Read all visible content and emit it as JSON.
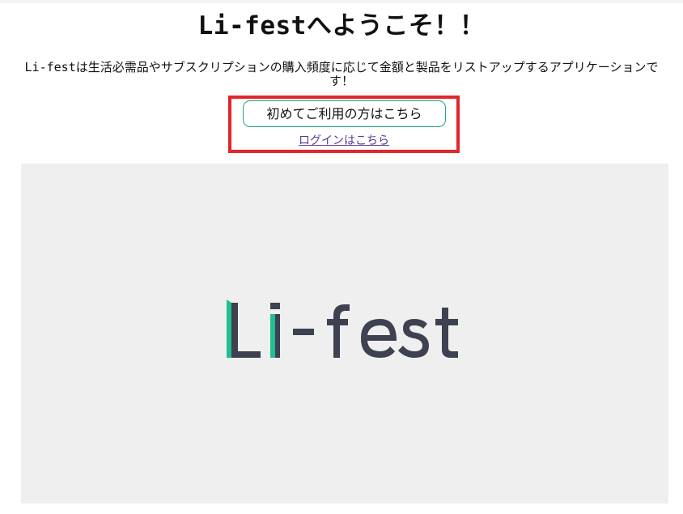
{
  "header": {
    "title": "Li-festへようこそ！！",
    "description": "Li-festは生活必需品やサブスクリプションの購入頻度に応じて金額と製品をリストアップするアプリケーションです！"
  },
  "actions": {
    "register_label": "初めてご利用の方はこちら",
    "login_label": "ログインはこちら"
  },
  "hero": {
    "logo_text": "Li-fest",
    "logo_colors": {
      "accent": "#1fbf8f",
      "text": "#3d4150"
    }
  },
  "colors": {
    "highlight_border": "#e0262b",
    "button_border": "#1fa882",
    "link": "#5b3a8f",
    "hero_background": "#efefef"
  }
}
